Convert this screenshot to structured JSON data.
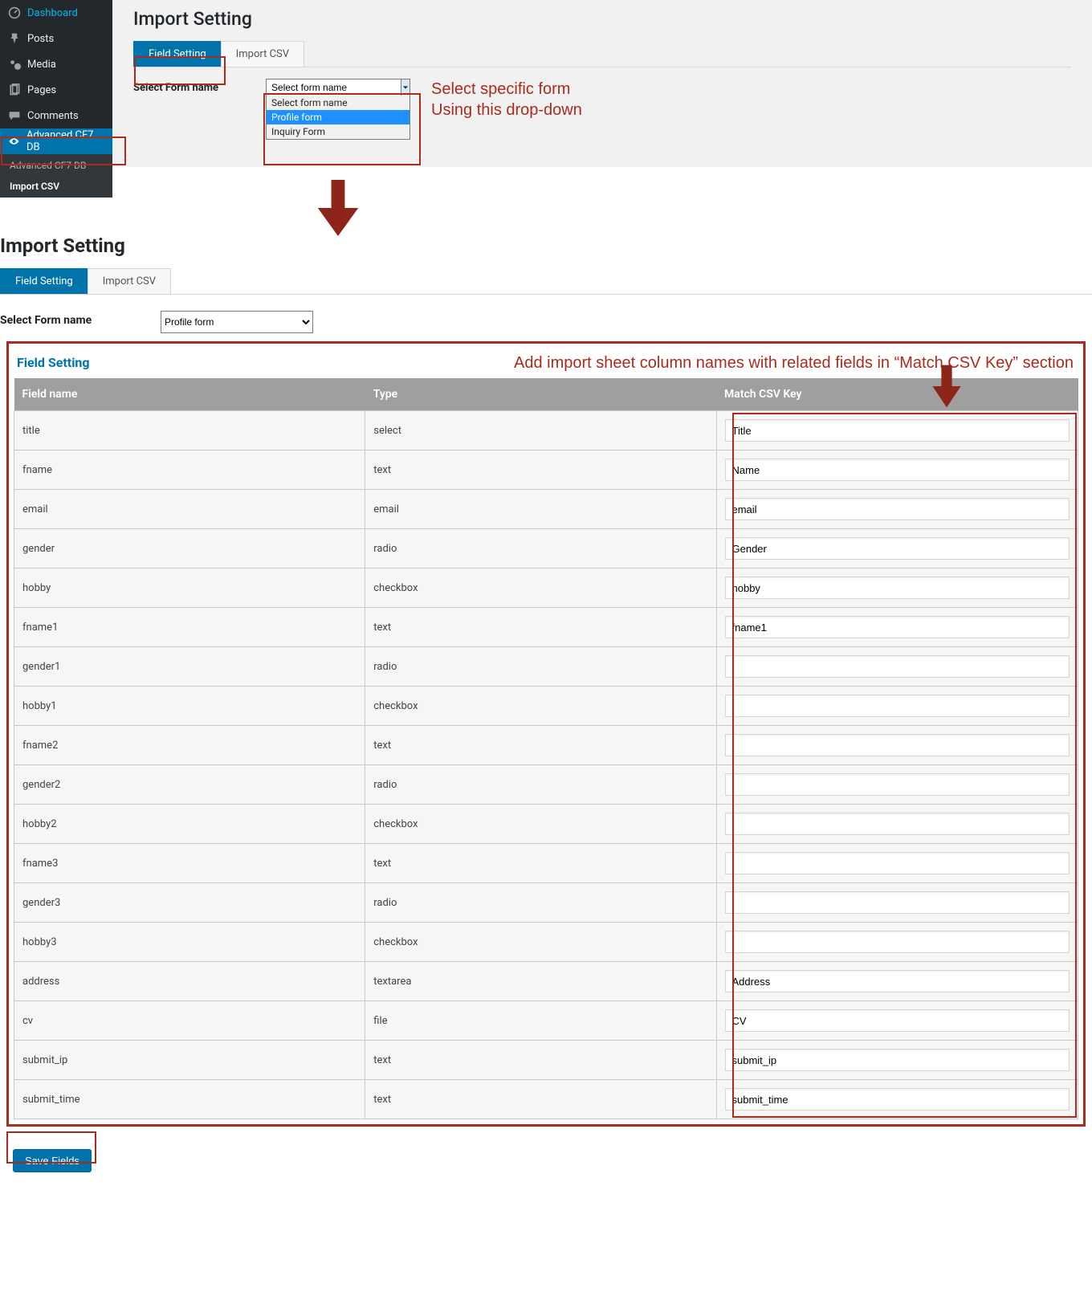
{
  "sidebar": {
    "items": [
      {
        "label": "Dashboard",
        "icon": "dashboard"
      },
      {
        "label": "Posts",
        "icon": "pin"
      },
      {
        "label": "Media",
        "icon": "media"
      },
      {
        "label": "Pages",
        "icon": "pages"
      },
      {
        "label": "Comments",
        "icon": "comments"
      },
      {
        "label": "Advanced CF7 DB",
        "icon": "eye",
        "active": true
      }
    ],
    "submenu": [
      {
        "label": "Advanced CF7 DB",
        "active": false
      },
      {
        "label": "Import CSV",
        "active": true
      }
    ]
  },
  "top": {
    "title": "Import Setting",
    "tabs": [
      {
        "label": "Field Setting",
        "active": true
      },
      {
        "label": "Import CSV",
        "active": false
      }
    ],
    "form_label": "Select Form name",
    "open_select": {
      "placeholder": "Select form name",
      "options": [
        "Select form name",
        "Profile form",
        "Inquiry Form"
      ],
      "hl_index": 1
    },
    "anno_top": "Select specific form\nUsing this drop-down"
  },
  "mid": {
    "title": "Import Setting",
    "tabs": [
      {
        "label": "Field Setting",
        "active": true
      },
      {
        "label": "Import CSV",
        "active": false
      }
    ],
    "form_label": "Select Form name",
    "select_value": "Profile form"
  },
  "fieldsetting": {
    "heading": "Field Setting",
    "anno": "Add import sheet column names with related fields in “Match CSV Key” section",
    "columns": [
      "Field name",
      "Type",
      "Match CSV Key"
    ],
    "rows": [
      {
        "name": "title",
        "type": "select",
        "key": "Title"
      },
      {
        "name": "fname",
        "type": "text",
        "key": "Name"
      },
      {
        "name": "email",
        "type": "email",
        "key": "email"
      },
      {
        "name": "gender",
        "type": "radio",
        "key": "Gender"
      },
      {
        "name": "hobby",
        "type": "checkbox",
        "key": "hobby"
      },
      {
        "name": "fname1",
        "type": "text",
        "key": "fname1"
      },
      {
        "name": "gender1",
        "type": "radio",
        "key": ""
      },
      {
        "name": "hobby1",
        "type": "checkbox",
        "key": ""
      },
      {
        "name": "fname2",
        "type": "text",
        "key": ""
      },
      {
        "name": "gender2",
        "type": "radio",
        "key": ""
      },
      {
        "name": "hobby2",
        "type": "checkbox",
        "key": ""
      },
      {
        "name": "fname3",
        "type": "text",
        "key": ""
      },
      {
        "name": "gender3",
        "type": "radio",
        "key": ""
      },
      {
        "name": "hobby3",
        "type": "checkbox",
        "key": ""
      },
      {
        "name": "address",
        "type": "textarea",
        "key": "Address"
      },
      {
        "name": "cv",
        "type": "file",
        "key": "CV"
      },
      {
        "name": "submit_ip",
        "type": "text",
        "key": "submit_ip"
      },
      {
        "name": "submit_time",
        "type": "text",
        "key": "submit_time"
      }
    ]
  },
  "buttons": {
    "save": "Save Fields"
  }
}
